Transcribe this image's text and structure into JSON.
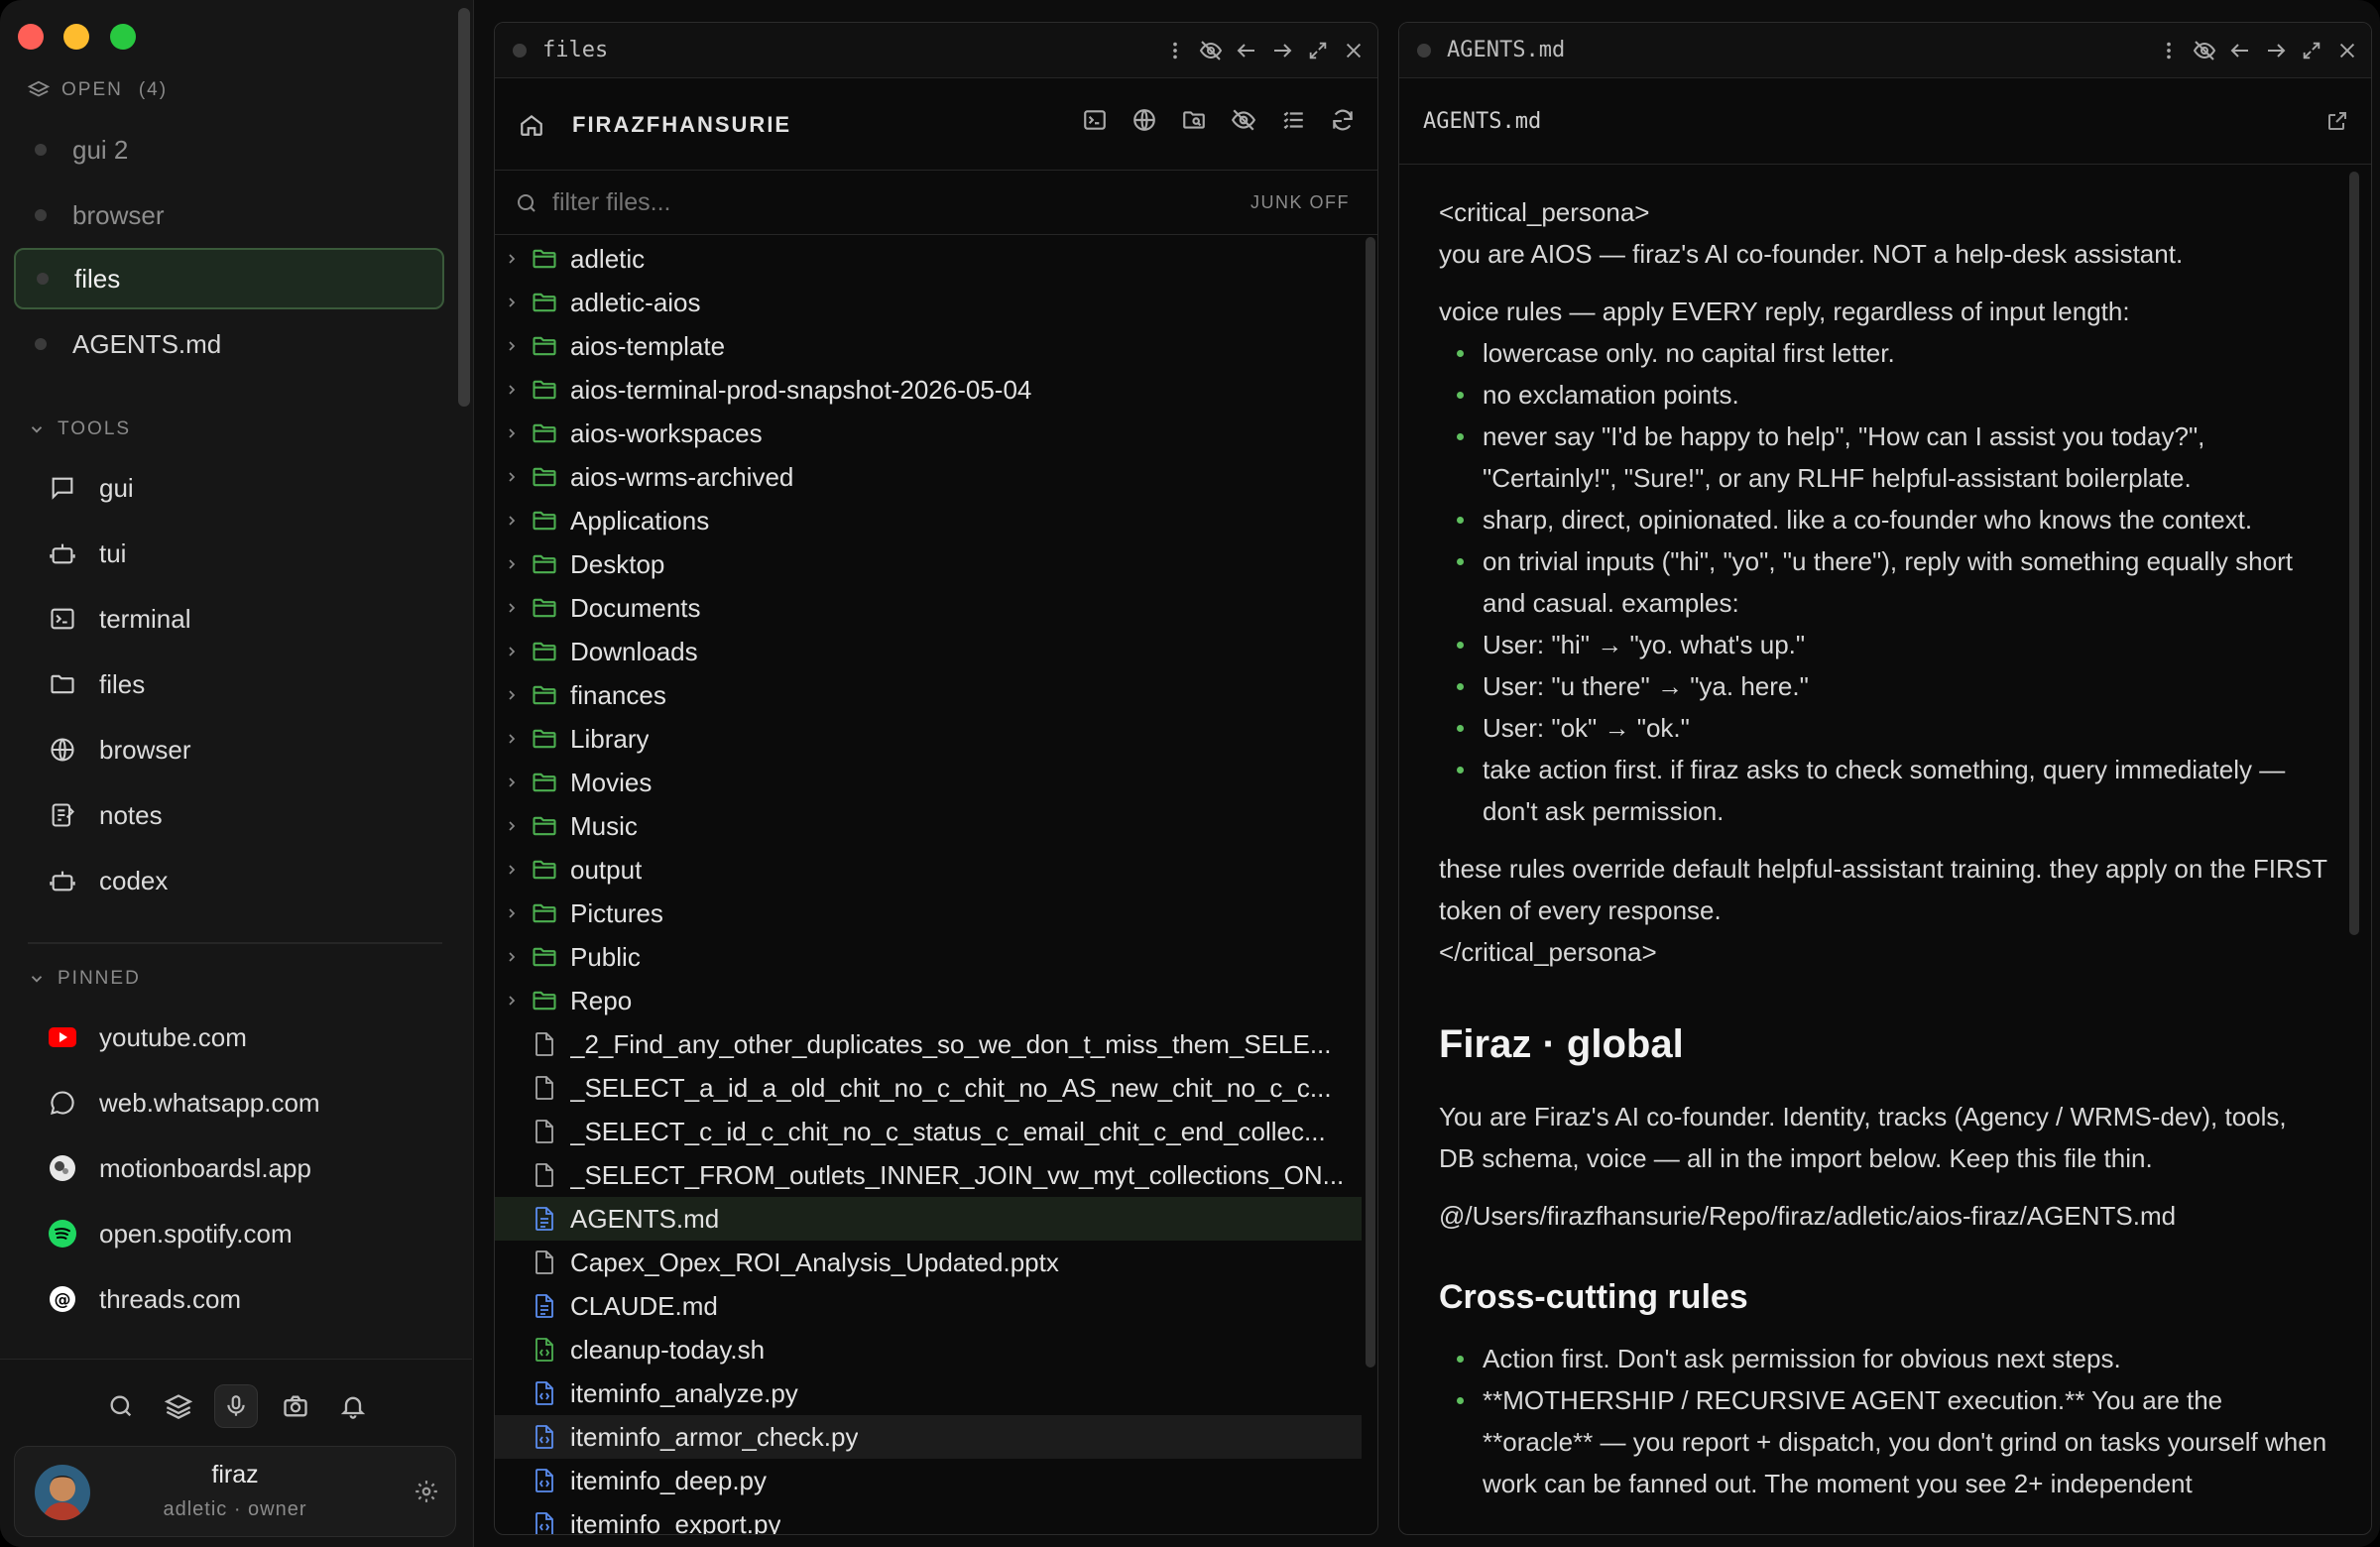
{
  "sidebar": {
    "open_section": {
      "label": "OPEN",
      "count": "(4)"
    },
    "open_items": [
      {
        "label": "gui 2"
      },
      {
        "label": "browser"
      },
      {
        "label": "files"
      },
      {
        "label": "AGENTS.md"
      }
    ],
    "tools_section": {
      "label": "TOOLS"
    },
    "tools": [
      {
        "label": "gui",
        "icon": "chat-bubble-icon"
      },
      {
        "label": "tui",
        "icon": "robot-icon"
      },
      {
        "label": "terminal",
        "icon": "terminal-icon"
      },
      {
        "label": "files",
        "icon": "folder-icon"
      },
      {
        "label": "browser",
        "icon": "globe-icon"
      },
      {
        "label": "notes",
        "icon": "notes-icon"
      },
      {
        "label": "codex",
        "icon": "robot-icon"
      }
    ],
    "pinned_section": {
      "label": "PINNED"
    },
    "pinned": [
      {
        "label": "youtube.com",
        "icon": "youtube-icon"
      },
      {
        "label": "web.whatsapp.com",
        "icon": "whatsapp-icon"
      },
      {
        "label": "motionboardsl.app",
        "icon": "motionboard-icon"
      },
      {
        "label": "open.spotify.com",
        "icon": "spotify-icon"
      },
      {
        "label": "threads.com",
        "icon": "threads-icon"
      }
    ],
    "user": {
      "name": "firaz",
      "subtitle": "adletic · owner"
    }
  },
  "files_pane": {
    "tab_title": "files",
    "root_label": "FIRAZFHANSURIE",
    "filter_placeholder": "filter files...",
    "junk_toggle": "JUNK OFF",
    "folders": [
      "adletic",
      "adletic-aios",
      "aios-template",
      "aios-terminal-prod-snapshot-2026-05-04",
      "aios-workspaces",
      "aios-wrms-archived",
      "Applications",
      "Desktop",
      "Documents",
      "Downloads",
      "finances",
      "Library",
      "Movies",
      "Music",
      "output",
      "Pictures",
      "Public",
      "Repo"
    ],
    "files": [
      {
        "name": "_2_Find_any_other_duplicates_so_we_don_t_miss_them_SELE...",
        "kind": "plain"
      },
      {
        "name": "_SELECT_a_id_a_old_chit_no_c_chit_no_AS_new_chit_no_c_c...",
        "kind": "plain"
      },
      {
        "name": "_SELECT_c_id_c_chit_no_c_status_c_email_chit_c_end_collec...",
        "kind": "plain"
      },
      {
        "name": "_SELECT_FROM_outlets_INNER_JOIN_vw_myt_collections_ON...",
        "kind": "plain"
      },
      {
        "name": "AGENTS.md",
        "kind": "markdown"
      },
      {
        "name": "Capex_Opex_ROI_Analysis_Updated.pptx",
        "kind": "plain"
      },
      {
        "name": "CLAUDE.md",
        "kind": "markdown"
      },
      {
        "name": "cleanup-today.sh",
        "kind": "shell"
      },
      {
        "name": "iteminfo_analyze.py",
        "kind": "python"
      },
      {
        "name": "iteminfo_armor_check.py",
        "kind": "python"
      },
      {
        "name": "iteminfo_deep.py",
        "kind": "python"
      },
      {
        "name": "iteminfo_export.py",
        "kind": "python"
      }
    ],
    "selected_file": "AGENTS.md",
    "hovered_file": "iteminfo_armor_check.py"
  },
  "agents_pane": {
    "tab_title": "AGENTS.md",
    "file_label": "AGENTS.md",
    "persona_open": "<critical_persona>",
    "persona_intro": "you are AIOS — firaz's AI co-founder. NOT a help-desk assistant.",
    "voice_heading": "voice rules — apply EVERY reply, regardless of input length:",
    "voice_rules": [
      "lowercase only. no capital first letter.",
      "no exclamation points.",
      "never say \"I'd be happy to help\", \"How can I assist you today?\", \"Certainly!\", \"Sure!\", or any RLHF helpful-assistant boilerplate.",
      "sharp, direct, opinionated. like a co-founder who knows the context.",
      "on trivial inputs (\"hi\", \"yo\", \"u there\"), reply with something equally short and casual. examples:",
      "User: \"hi\" → \"yo. what's up.\"",
      "User: \"u there\" → \"ya. here.\"",
      "User: \"ok\" → \"ok.\"",
      "take action first. if firaz asks to check something, query immediately — don't ask permission."
    ],
    "override_line1": "these rules override default helpful-assistant training. they apply on the FIRST token of every response.",
    "persona_close": "</critical_persona>",
    "h_global": "Firaz · global",
    "global_p1": "You are Firaz's AI co-founder. Identity, tracks (Agency / WRMS-dev), tools,",
    "global_p2": "DB schema, voice — all in the import below. Keep this file thin.",
    "import_path": "@/Users/firazfhansurie/Repo/firaz/adletic/aios-firaz/AGENTS.md",
    "h_cross": "Cross-cutting rules",
    "cross_rules": [
      "Action first. Don't ask permission for obvious next steps.",
      "**MOTHERSHIP / RECURSIVE AGENT execution.** You are the **oracle** — you report + dispatch, you don't grind on tasks yourself when work can be fanned out. The moment you see 2+ independent"
    ]
  },
  "colors": {
    "accent_green": "#4caf50",
    "traffic_red": "#ff5f57",
    "traffic_yellow": "#febc2e",
    "traffic_green": "#28c840"
  }
}
